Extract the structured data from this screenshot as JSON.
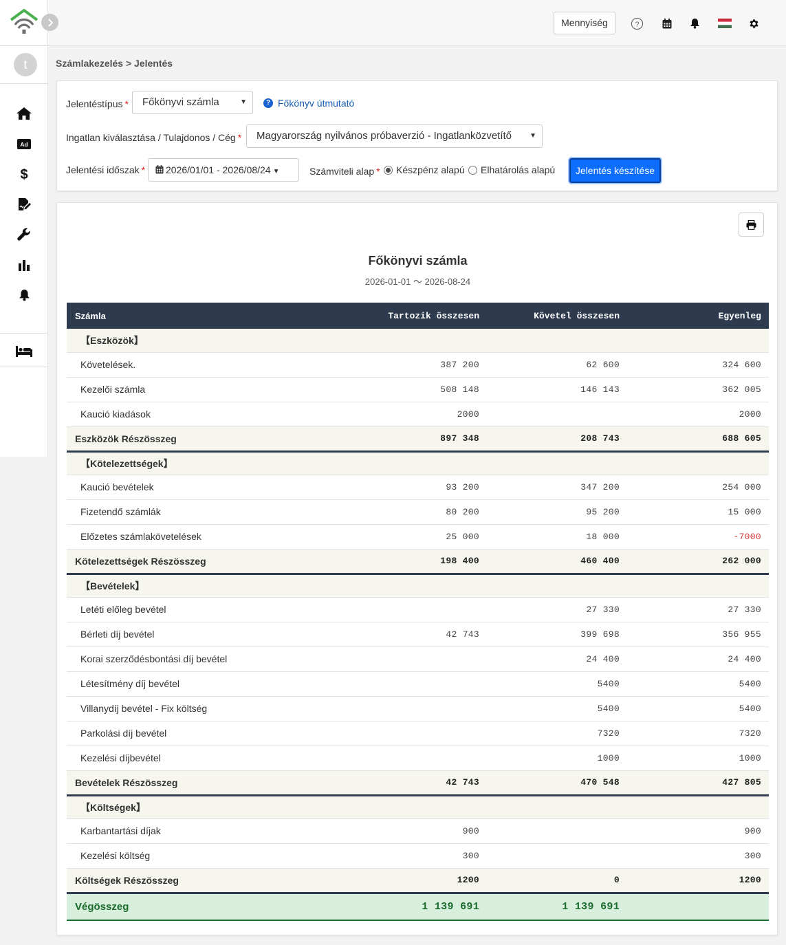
{
  "header": {
    "quantity_button": "Mennyiség",
    "icons": [
      "help-icon",
      "calendar-icon",
      "bell-icon",
      "hungarian-flag-icon",
      "gear-icon"
    ]
  },
  "sidebar": {
    "avatar_letter": "t",
    "items": [
      "home-icon",
      "ad-icon",
      "dollar-icon",
      "contract-icon",
      "wrench-icon",
      "bar-chart-icon",
      "bell-icon",
      "bed-icon"
    ]
  },
  "breadcrumb": "Számlakezelés > Jelentés",
  "filters": {
    "report_type_label": "Jelentéstípus",
    "report_type_value": "Főkönyvi számla",
    "help_link": "Főkönyv útmutató",
    "property_label": "Ingatlan kiválasztása / Tulajdonos / Cég",
    "property_value": "Magyarország nyilvános próbaverzió - Ingatlanközvetítő",
    "period_label": "Jelentési időszak",
    "period_value": "2026/01/01 - 2026/08/24",
    "basis_label": "Számviteli alap",
    "basis_options": [
      "Készpénz alapú",
      "Elhatárolás alapú"
    ],
    "basis_selected": "Készpénz alapú",
    "submit_label": "Jelentés készítése"
  },
  "report": {
    "title": "Főkönyvi számla",
    "subtitle": "2026-01-01 〜 2026-08-24",
    "columns": [
      "Számla",
      "Tartozik összesen",
      "Követel összesen",
      "Egyenleg"
    ],
    "rows": [
      {
        "type": "section",
        "name": "【Eszközök】"
      },
      {
        "type": "row",
        "name": "Követelések.",
        "debit": "387 200",
        "credit": "62 600",
        "balance": "324 600"
      },
      {
        "type": "row",
        "name": "Kezelői számla",
        "debit": "508 148",
        "credit": "146 143",
        "balance": "362 005"
      },
      {
        "type": "row",
        "name": "Kaució kiadások",
        "debit": "2000",
        "credit": "",
        "balance": "2000"
      },
      {
        "type": "subtotal",
        "name": "Eszközök Részösszeg",
        "debit": "897 348",
        "credit": "208 743",
        "balance": "688 605"
      },
      {
        "type": "section",
        "name": "【Kötelezettségek】"
      },
      {
        "type": "row",
        "name": "Kaució bevételek",
        "debit": "93 200",
        "credit": "347 200",
        "balance": "254 000"
      },
      {
        "type": "row",
        "name": "Fizetendő számlák",
        "debit": "80 200",
        "credit": "95 200",
        "balance": "15 000"
      },
      {
        "type": "row",
        "name": "Előzetes számlakövetelések",
        "debit": "25 000",
        "credit": "18 000",
        "balance": "-7000",
        "negative": true
      },
      {
        "type": "subtotal",
        "name": "Kötelezettségek Részösszeg",
        "debit": "198 400",
        "credit": "460 400",
        "balance": "262 000"
      },
      {
        "type": "section",
        "name": "【Bevételek】"
      },
      {
        "type": "row",
        "name": "Letéti előleg bevétel",
        "debit": "",
        "credit": "27 330",
        "balance": "27 330"
      },
      {
        "type": "row",
        "name": "Bérleti díj bevétel",
        "debit": "42 743",
        "credit": "399 698",
        "balance": "356 955"
      },
      {
        "type": "row",
        "name": "Korai szerződésbontási díj bevétel",
        "debit": "",
        "credit": "24 400",
        "balance": "24 400"
      },
      {
        "type": "row",
        "name": "Létesítmény díj bevétel",
        "debit": "",
        "credit": "5400",
        "balance": "5400"
      },
      {
        "type": "row",
        "name": "Villanydíj bevétel - Fix költség",
        "debit": "",
        "credit": "5400",
        "balance": "5400"
      },
      {
        "type": "row",
        "name": "Parkolási díj bevétel",
        "debit": "",
        "credit": "7320",
        "balance": "7320"
      },
      {
        "type": "row",
        "name": "Kezelési díjbevétel",
        "debit": "",
        "credit": "1000",
        "balance": "1000"
      },
      {
        "type": "subtotal",
        "name": "Bevételek Részösszeg",
        "debit": "42 743",
        "credit": "470 548",
        "balance": "427 805"
      },
      {
        "type": "section",
        "name": "【Költségek】"
      },
      {
        "type": "row",
        "name": "Karbantartási díjak",
        "debit": "900",
        "credit": "",
        "balance": "900"
      },
      {
        "type": "row",
        "name": "Kezelési költség",
        "debit": "300",
        "credit": "",
        "balance": "300"
      },
      {
        "type": "subtotal",
        "name": "Költségek Részösszeg",
        "debit": "1200",
        "credit": "0",
        "balance": "1200"
      },
      {
        "type": "grand",
        "name": "Végösszeg",
        "debit": "1 139 691",
        "credit": "1 139 691",
        "balance": ""
      }
    ]
  }
}
